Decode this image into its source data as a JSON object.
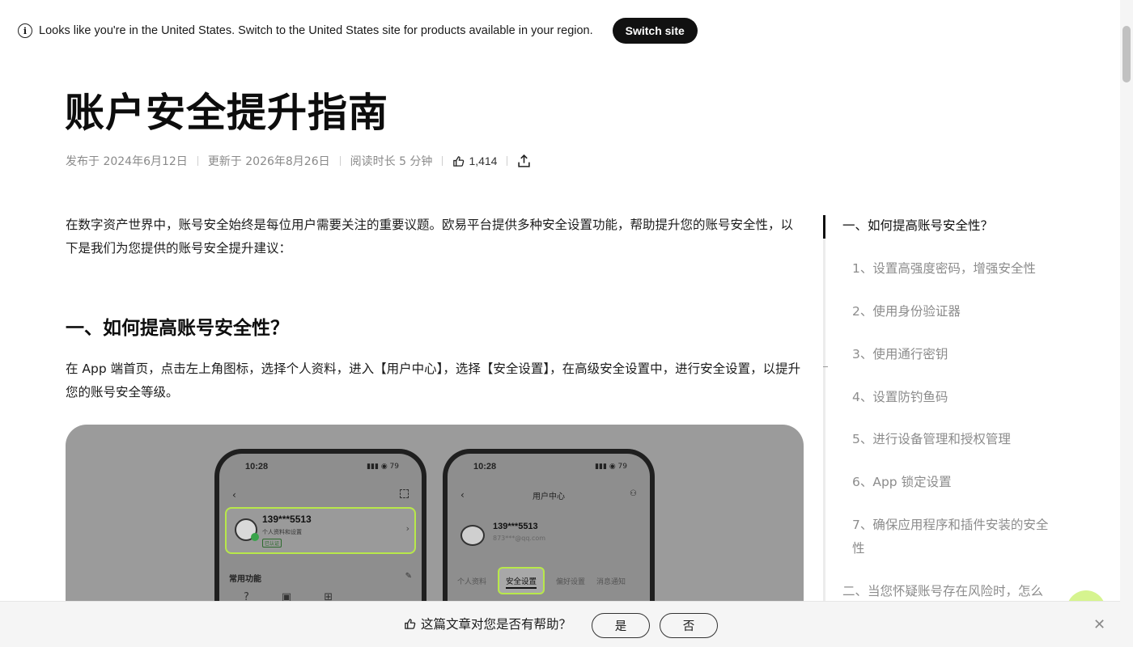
{
  "banner": {
    "icon": "info-icon",
    "message": "Looks like you're in the United States. Switch to the United States site for products available in your region.",
    "switch_label": "Switch site"
  },
  "article": {
    "title": "账户安全提升指南",
    "meta": {
      "published": "发布于 2024年6月12日",
      "updated": "更新于 2026年8月26日",
      "read_time": "阅读时长 5 分钟",
      "likes": "1,414"
    },
    "intro": "在数字资产世界中，账号安全始终是每位用户需要关注的重要议题。欧易平台提供多种安全设置功能，帮助提升您的账号安全性，以下是我们为您提供的账号安全提升建议：",
    "section1_heading": "一、如何提高账号安全性？",
    "section1_body": "在 App 端首页，点击左上角图标，选择个人资料，进入【用户中心】，选择【安全设置】，在高级安全设置中，进行安全设置，以提升您的账号安全等级。",
    "figure": {
      "phone1": {
        "time": "10:28",
        "status": "▮▮▮ ◉ 79",
        "phone_number": "139***5513",
        "sub": "个人资料和设置",
        "badge": "已认证",
        "section": "常用功能"
      },
      "phone2": {
        "time": "10:28",
        "status": "▮▮▮ ◉ 79",
        "title": "用户中心",
        "phone_number": "139***5513",
        "email": "873***@qq.com",
        "tabs": [
          "个人资料",
          "安全设置",
          "偏好设置",
          "消息通知"
        ]
      }
    }
  },
  "toc": {
    "items": [
      "一、如何提高账号安全性？",
      "1、设置高强度密码，增强安全性",
      "2、使用身份验证器",
      "3、使用通行密钥",
      "4、设置防钓鱼码",
      "5、进行设备管理和授权管理",
      "6、App 锁定设置",
      "7、确保应用程序和插件安装的安全性",
      "二、当您怀疑账号存在风险时，怎么"
    ]
  },
  "feedback": {
    "question": "这篇文章对您是否有帮助？",
    "yes": "是",
    "no": "否",
    "close": "✕"
  },
  "colors": {
    "accent": "#b8e84a",
    "text": "#121212",
    "muted": "#8c8c8c"
  }
}
